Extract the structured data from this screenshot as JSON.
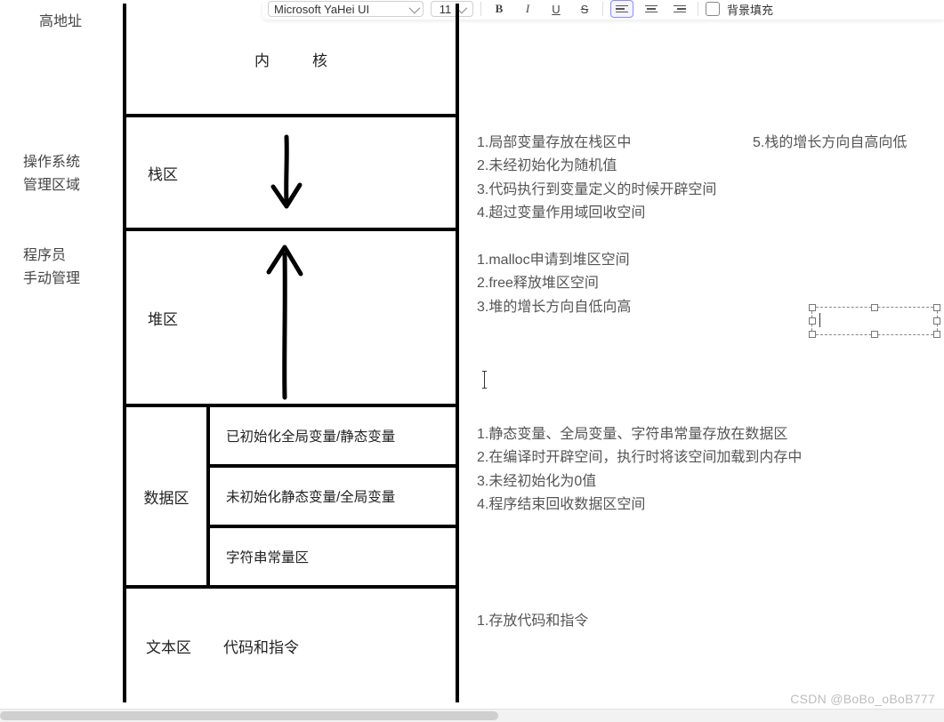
{
  "toolbar": {
    "font": "Microsoft YaHei UI",
    "size": "11",
    "bgFillLabel": "背景填充"
  },
  "labels": {
    "highAddress": "高地址",
    "osManaged1": "操作系统",
    "osManaged2": "管理区域",
    "programmer1": "程序员",
    "programmer2": "手动管理"
  },
  "diagram": {
    "kernel": "内核",
    "stack": "栈区",
    "heap": "堆区",
    "dataLabel": "数据区",
    "dataSub1": "已初始化全局变量/静态变量",
    "dataSub2": "未初始化静态变量/全局变量",
    "dataSub3": "字符串常量区",
    "textLabel": "文本区",
    "textContent": "代码和指令"
  },
  "notes": {
    "stack": [
      "1.局部变量存放在栈区中",
      "2.未经初始化为随机值",
      "3.代码执行到变量定义的时候开辟空间",
      "4.超过变量作用域回收空间"
    ],
    "heap": [
      "1.malloc申请到堆区空间",
      "2.free释放堆区空间",
      "3.堆的增长方向自低向高"
    ],
    "data": [
      "1.静态变量、全局变量、字符串常量存放在数据区",
      "2.在编译时开辟空间，执行时将该空间加载到内存中",
      "3.未经初始化为0值",
      "4.程序结束回收数据区空间"
    ],
    "text": [
      "1.存放代码和指令"
    ],
    "extra": "5.栈的增长方向自高向低"
  },
  "watermark": "CSDN @BoBo_oBoB777"
}
